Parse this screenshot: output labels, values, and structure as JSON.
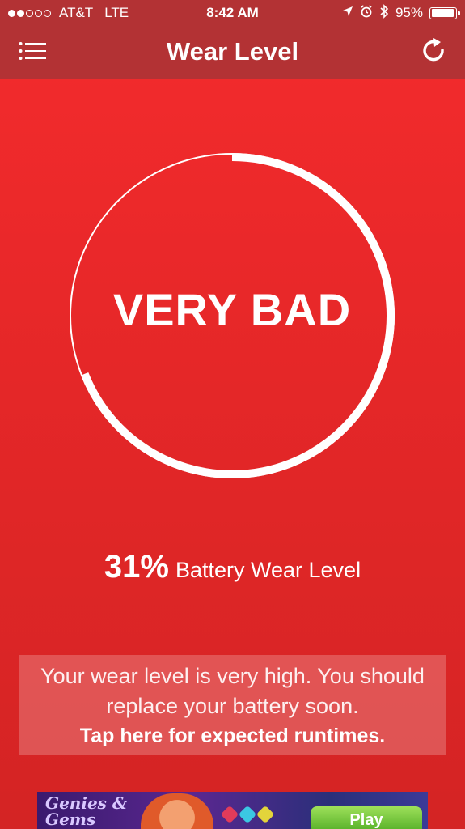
{
  "status_bar": {
    "carrier": "AT&T",
    "network": "LTE",
    "time": "8:42 AM",
    "battery_text": "95%",
    "battery_level": 0.95,
    "signal_bars": 2,
    "signal_total": 5
  },
  "nav": {
    "title": "Wear Level",
    "menu_icon": "list-menu-icon",
    "refresh_icon": "refresh-icon"
  },
  "gauge": {
    "label": "VERY BAD",
    "percent": 31
  },
  "wear": {
    "percent_text": "31%",
    "label": "Battery Wear Level"
  },
  "advice": {
    "message": "Your wear level is very high. You should replace your battery soon.",
    "cta": "Tap here for expected runtimes."
  },
  "ad": {
    "title": "Genies & Gems",
    "button": "Play"
  },
  "colors": {
    "background_top": "#f42b2d",
    "background_bottom": "#d42424",
    "bar": "#b33234",
    "text": "#ffffff"
  }
}
